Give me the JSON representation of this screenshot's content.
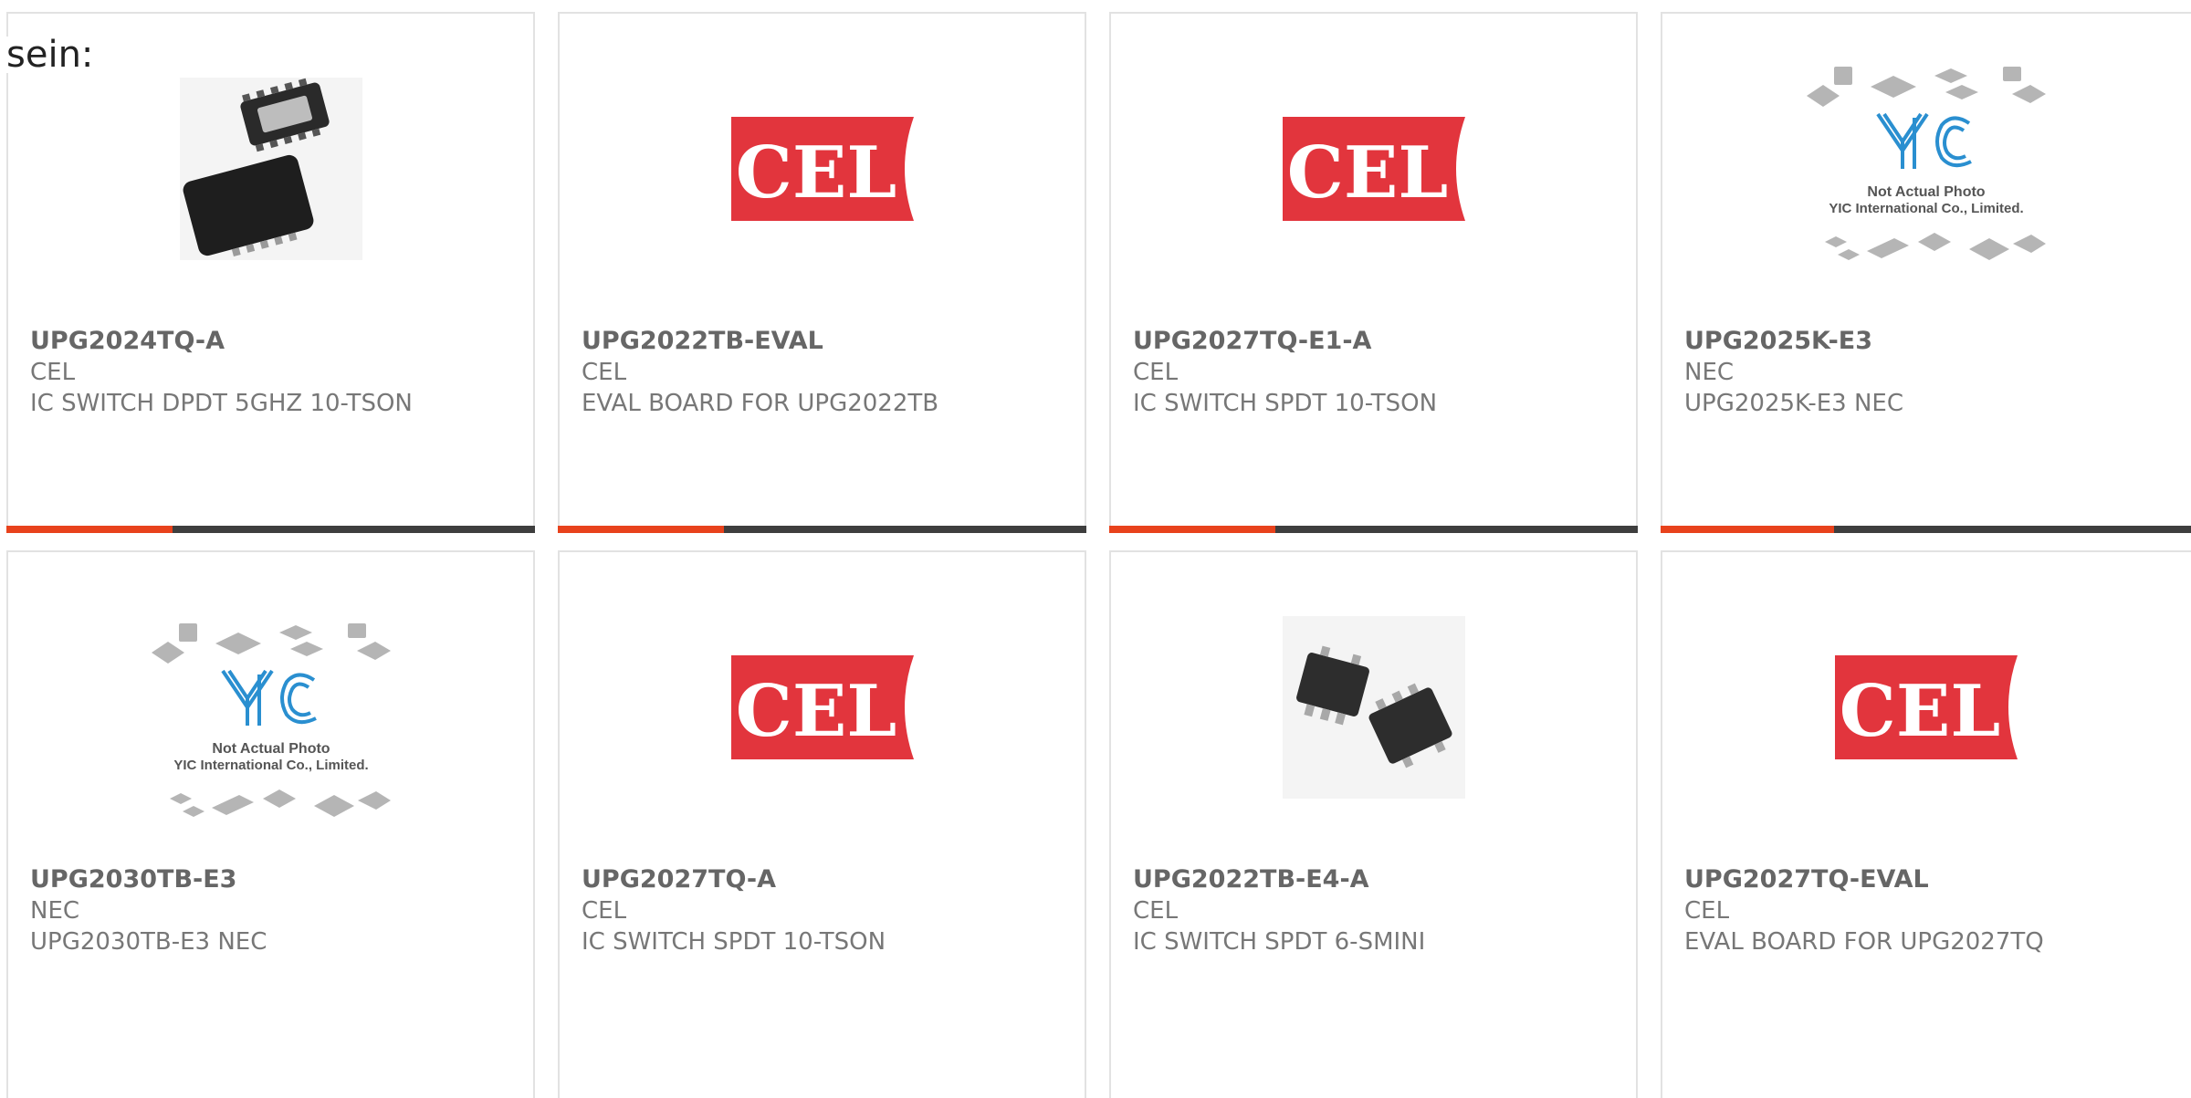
{
  "heading": "sein:",
  "products": [
    {
      "part": "UPG2024TQ-A",
      "maker": "CEL",
      "description": "IC SWITCH DPDT 5GHZ 10-TSON",
      "image": "tson-package-photo"
    },
    {
      "part": "UPG2022TB-EVAL",
      "maker": "CEL",
      "description": "EVAL BOARD FOR UPG2022TB",
      "image": "cel-logo"
    },
    {
      "part": "UPG2027TQ-E1-A",
      "maker": "CEL",
      "description": "IC SWITCH SPDT 10-TSON",
      "image": "cel-logo"
    },
    {
      "part": "UPG2025K-E3",
      "maker": "NEC",
      "description": "UPG2025K-E3 NEC",
      "image": "yic-placeholder"
    },
    {
      "part": "UPG2030TB-E3",
      "maker": "NEC",
      "description": "UPG2030TB-E3 NEC",
      "image": "yic-placeholder"
    },
    {
      "part": "UPG2027TQ-A",
      "maker": "CEL",
      "description": "IC SWITCH SPDT 10-TSON",
      "image": "cel-logo"
    },
    {
      "part": "UPG2022TB-E4-A",
      "maker": "CEL",
      "description": "IC SWITCH SPDT 6-SMINI",
      "image": "sot-package-photo"
    },
    {
      "part": "UPG2027TQ-EVAL",
      "maker": "CEL",
      "description": "EVAL BOARD FOR UPG2027TQ",
      "image": "cel-logo"
    }
  ],
  "logo_text": {
    "cel": "CEL",
    "yic_mark": "YIC",
    "yic_caption_1": "Not Actual Photo",
    "yic_caption_2": "YIC International Co., Limited."
  },
  "colors": {
    "accent": "#e8421c",
    "bar": "#3e3e3e",
    "cel_red": "#e2353d",
    "yic_blue": "#2a8fd0"
  }
}
